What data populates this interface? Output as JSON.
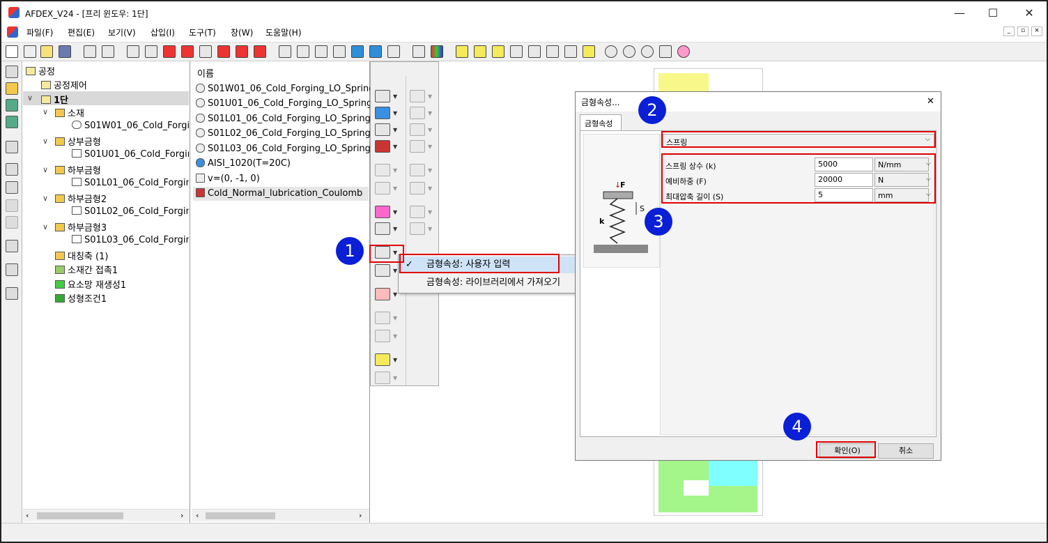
{
  "window": {
    "title": "AFDEX_V24 - [프리 윈도우: 1단]",
    "min": "—",
    "max": "☐",
    "close": "✕"
  },
  "menu": [
    "파일(F)",
    "편집(E)",
    "보기(V)",
    "삽입(I)",
    "도구(T)",
    "창(W)",
    "도움말(H)"
  ],
  "tree": {
    "root": "공정",
    "items": [
      {
        "label": "공정제어"
      },
      {
        "label": "1단"
      },
      {
        "label": "소재"
      },
      {
        "label": "S01W01_06_Cold_Forgi"
      },
      {
        "label": "상부금형"
      },
      {
        "label": "S01U01_06_Cold_Forgir"
      },
      {
        "label": "하부금형"
      },
      {
        "label": "S01L01_06_Cold_Forgin"
      },
      {
        "label": "하부금형2"
      },
      {
        "label": "S01L02_06_Cold_Forgin"
      },
      {
        "label": "하부금형3"
      },
      {
        "label": "S01L03_06_Cold_Forgin"
      },
      {
        "label": "대칭축 (1)"
      },
      {
        "label": "소재간 접촉1"
      },
      {
        "label": "요소망 재생성1"
      },
      {
        "label": "성형조건1"
      }
    ]
  },
  "list": {
    "header": "이름",
    "items": [
      "S01W01_06_Cold_Forging_LO_Spring",
      "S01U01_06_Cold_Forging_LO_Spring",
      "S01L01_06_Cold_Forging_LO_Spring .",
      "S01L02_06_Cold_Forging_LO_Spring .",
      "S01L03_06_Cold_Forging_LO_Spring .",
      "AISI_1020(T=20C)",
      "v=(0, -1, 0)",
      "Cold_Normal_lubrication_Coulomb"
    ]
  },
  "popup": {
    "item1": "금형속성: 사용자 입력",
    "item1_check": "✓",
    "item2": "금형속성: 라이브러리에서 가져오기"
  },
  "dialog": {
    "title": "금형속성...",
    "close": "✕",
    "tab": "금형속성",
    "type_value": "스프링",
    "diagram": {
      "f": "F",
      "s": "S",
      "k": "k"
    },
    "rows": [
      {
        "label": "스프링 상수 (k)",
        "value": "5000",
        "unit": "N/mm"
      },
      {
        "label": "예비하중 (F)",
        "value": "20000",
        "unit": "N"
      },
      {
        "label": "최대압축 길이 (S)",
        "value": "5",
        "unit": "mm"
      }
    ],
    "ok": "확인(O)",
    "cancel": "취소"
  },
  "badges": [
    "1",
    "2",
    "3",
    "4"
  ],
  "colors": {
    "badge": "#0a1fd6",
    "highlight": "#e10000",
    "popup_selected": "#cfe3f7"
  }
}
